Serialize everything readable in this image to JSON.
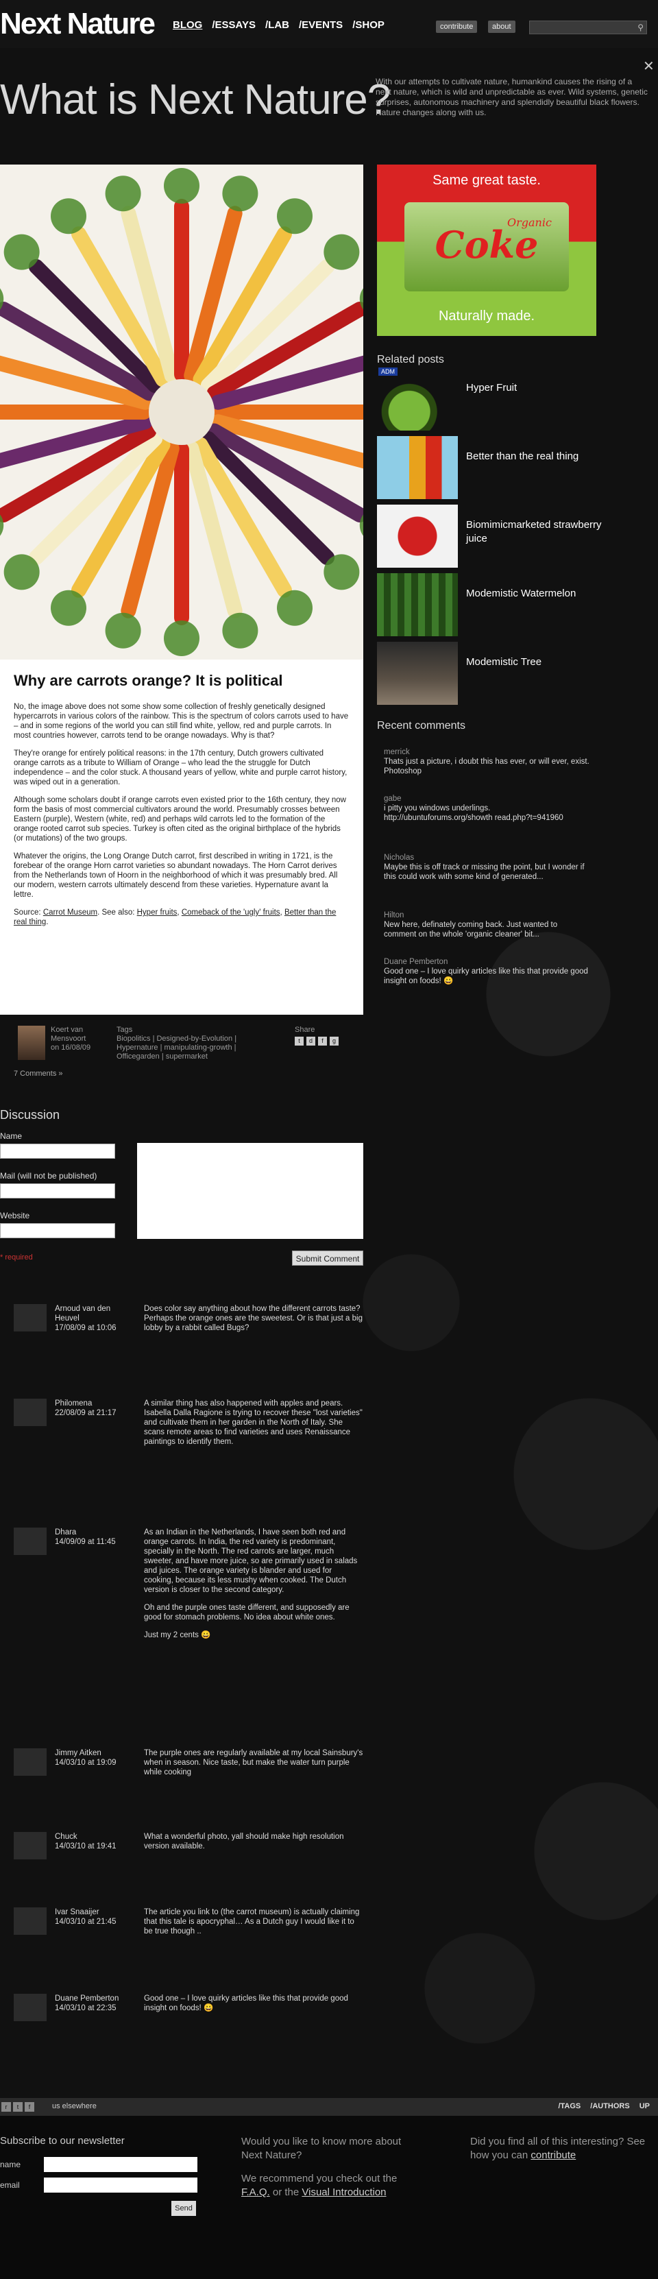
{
  "header": {
    "logo": "Next Nature",
    "nav": [
      "BLOG",
      "/ESSAYS",
      "/LAB",
      "/EVENTS",
      "/SHOP"
    ],
    "contribute": "contribute",
    "about": "about",
    "close": "✕"
  },
  "hero": {
    "title": "What is Next Nature?",
    "intro": "With our attempts to cultivate nature, humankind causes the rising of a next nature, which is wild and unpredictable as ever. Wild systems, genetic surprises, autonomous machinery and splendidly beautiful black flowers. Nature changes along with us."
  },
  "article": {
    "title": "Why are carrots orange? It is political",
    "p1": "No, the image above does not some show some collection of freshly genetically designed hypercarrots in various colors of the rainbow. This is the spectrum of colors carrots used to have – and in some regions of the world you can still find white, yellow, red and purple carrots. In most countries however, carrots tend to be orange nowadays. Why is that?",
    "p2": "They're orange for entirely political reasons: in the 17th century, Dutch growers cultivated orange carrots as a tribute to William of Orange – who lead the the struggle for Dutch independence – and the color stuck. A thousand years of yellow, white and purple carrot history, was wiped out in a generation.",
    "p3": "Although some scholars doubt if orange carrots even existed prior to the 16th century, they now form the basis of most commercial cultivators around the world. Presumably crosses between Eastern (purple), Western (white, red) and perhaps wild carrots led to the formation of the orange rooted carrot sub species. Turkey is often cited as the original birthplace of the hybrids (or mutations) of the two groups.",
    "p4": "Whatever the origins, the Long Orange Dutch carrot, first described in writing in 1721, is the forebear of the orange Horn carrot varieties so abundant nowadays. The Horn Carrot derives from the Netherlands town of Hoorn in the neighborhood of which it was presumably bred. All our modern, western carrots ultimately descend from these varieties. Hypernature avant la lettre.",
    "source_prefix": "Source: ",
    "source_link": "Carrot Museum",
    "see_also": ". See also: ",
    "link1": "Hyper fruits",
    "link2": "Comeback of the 'ugly' fruits",
    "link3": "Better than the real thing"
  },
  "meta": {
    "author": "Koert van Mensvoort on 16/08/09",
    "tags_label": "Tags",
    "tags": "Biopolitics | Designed-by-Evolution | Hypernature | manipulating-growth | Officegarden | supermarket",
    "share_label": "Share",
    "comments_count": "7 Comments »"
  },
  "form": {
    "title": "Discussion",
    "name_label": "Name",
    "mail_label": "Mail (will not be published)",
    "website_label": "Website",
    "required_note": "* required",
    "submit": "Submit Comment"
  },
  "comments": [
    {
      "author": "Arnoud van den Heuvel",
      "date": "17/08/09 at 10:06",
      "body": [
        "Does color say anything about how the different carrots taste? Perhaps the orange ones are the sweetest. Or is that just a big lobby by a rabbit called Bugs?"
      ]
    },
    {
      "author": "Philomena",
      "date": "22/08/09 at 21:17",
      "body": [
        "A similar thing has also happened with apples and pears.\nIsabella Dalla Ragione is trying to recover these \"lost varieties\" and cultivate them in her garden in the North of Italy. She scans remote areas to find varieties and uses Renaissance paintings to identify them."
      ]
    },
    {
      "author": "Dhara",
      "date": "14/09/09 at 11:45",
      "body": [
        "As an Indian in the Netherlands, I have seen both red and orange carrots. In India, the red variety is predominant, specially in the North. The red carrots are larger, much sweeter, and have more juice, so are primarily used in salads and juices. The orange variety is blander and used for cooking, because its less mushy when cooked. The Dutch version is closer to the second category.",
        "Oh and the purple ones taste different, and supposedly are good for stomach problems. No idea about white ones.",
        "Just my 2 cents 😀"
      ]
    },
    {
      "author": "Jimmy Aitken",
      "date": "14/03/10 at 19:09",
      "body": [
        "The purple ones are regularly available at my local Sainsbury's when in season. Nice taste, but make the water turn purple while cooking"
      ]
    },
    {
      "author": "Chuck",
      "date": "14/03/10 at 19:41",
      "body": [
        "What a wonderful photo, yall should make high resolution version available."
      ]
    },
    {
      "author": "Ivar Snaaijer",
      "date": "14/03/10 at 21:45",
      "body": [
        "The article you link to (the carrot museum) is actually claiming that this tale is apocryphal… As a Dutch guy I would like it to be true though .."
      ]
    },
    {
      "author": "Duane Pemberton",
      "date": "14/03/10 at 22:35",
      "body": [
        "Good one – I love quirky articles like this that provide good insight on foods! 😀"
      ]
    }
  ],
  "ad": {
    "top": "Same great taste.",
    "brand": "Coke",
    "organic": "Organic",
    "bottom": "Naturally made."
  },
  "sidebar": {
    "related_title": "Related posts",
    "adm": "ADM",
    "related": [
      "Hyper Fruit",
      "Better than the real thing",
      "Biomimicmarketed strawberry juice",
      "Modemistic Watermelon",
      "Modemistic Tree"
    ],
    "recent_title": "Recent comments",
    "recent": [
      {
        "name": "merrick",
        "text": "Thats just a picture, i doubt this has ever, or will ever, exist. Photoshop"
      },
      {
        "name": "gabe",
        "text": "i pitty you windows underlings. http://ubuntuforums.org/showth read.php?t=941960"
      },
      {
        "name": "Nicholas",
        "text": "Maybe this is off track or missing the point, but I wonder if this could work with some kind of generated..."
      },
      {
        "name": "Hilton",
        "text": "New here, definately coming back. Just wanted to comment on the whole 'organic cleaner' bit..."
      },
      {
        "name": "Duane Pemberton",
        "text": "Good one – I love quirky articles like this that provide good insight on foods! 😀"
      }
    ]
  },
  "footer": {
    "elsewhere": "us elsewhere",
    "links": [
      "/TAGS",
      "/AUTHORS",
      "UP"
    ],
    "newsletter_title": "Subscribe to our newsletter",
    "name_label": "name",
    "email_label": "email",
    "send": "Send",
    "mid_q": "Would you like to know more about Next Nature?",
    "mid_rec": "We recommend you check out the ",
    "faq": "F.A.Q.",
    "or_the": " or the ",
    "visual": "Visual Introduction",
    "right_q": "Did you find all of this interesting? See how you can ",
    "right_link": "contribute"
  },
  "colors": {
    "accent": "#d92323",
    "background": "#101010",
    "article_bg": "#ffffff"
  }
}
